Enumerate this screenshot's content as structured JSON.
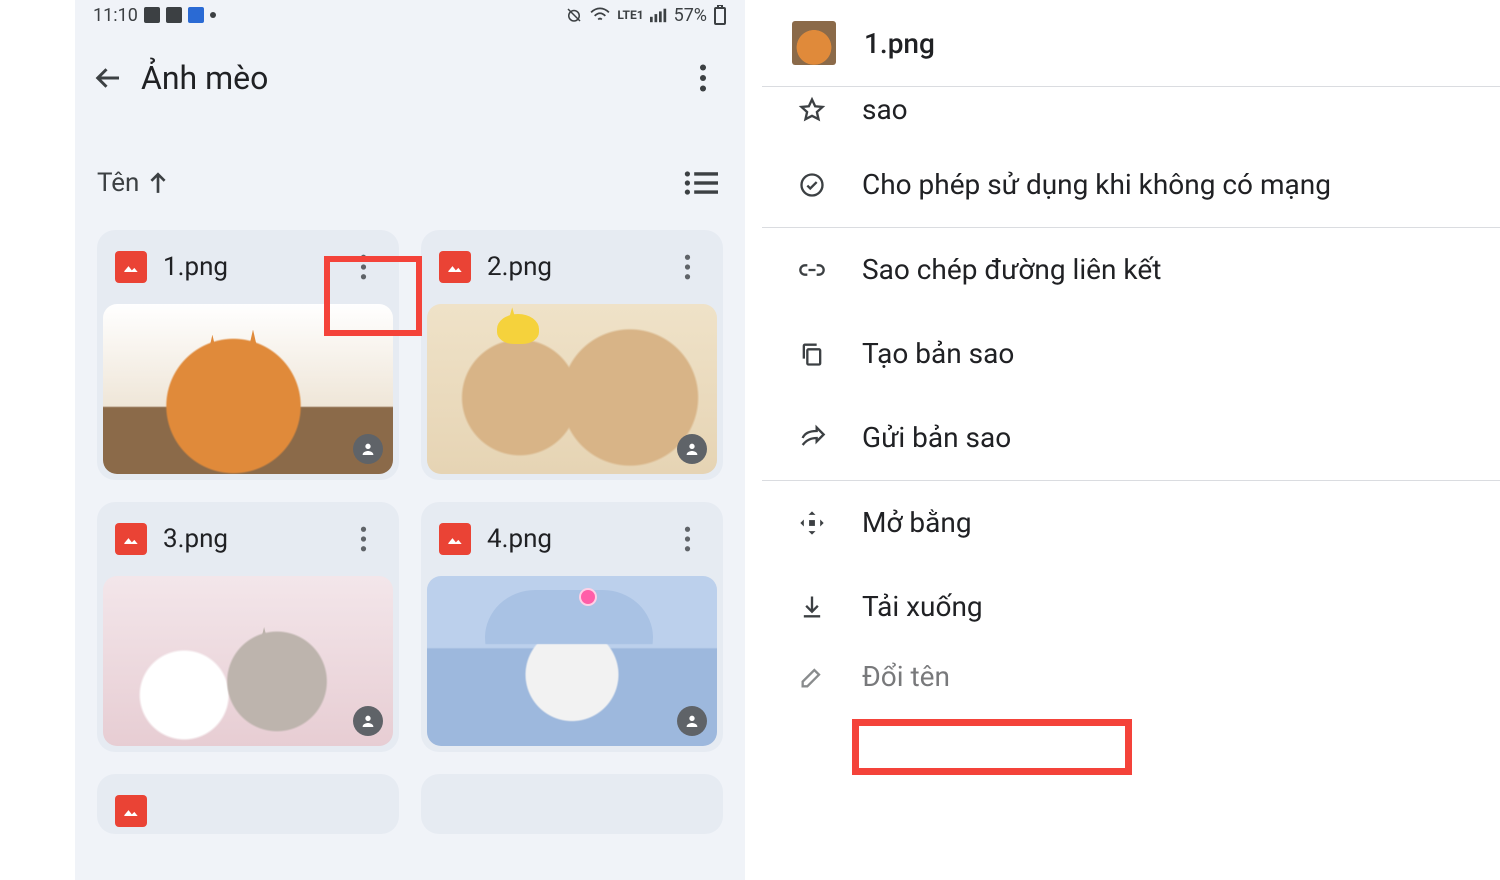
{
  "status": {
    "time": "11:10",
    "network_label": "LTE1",
    "battery": "57%"
  },
  "folder": {
    "title": "Ảnh mèo",
    "sort_label": "Tên",
    "files": [
      {
        "name": "1.png"
      },
      {
        "name": "2.png"
      },
      {
        "name": "3.png"
      },
      {
        "name": "4.png"
      }
    ]
  },
  "sheet": {
    "file_name": "1.png",
    "items": {
      "star_partial": "sao",
      "offline": "Cho phép sử dụng khi không có mạng",
      "copy_link": "Sao chép đường liên kết",
      "make_copy": "Tạo bản sao",
      "send_copy": "Gửi bản sao",
      "open_with": "Mở bằng",
      "download": "Tải xuống",
      "rename_partial": "Đổi tên"
    }
  }
}
